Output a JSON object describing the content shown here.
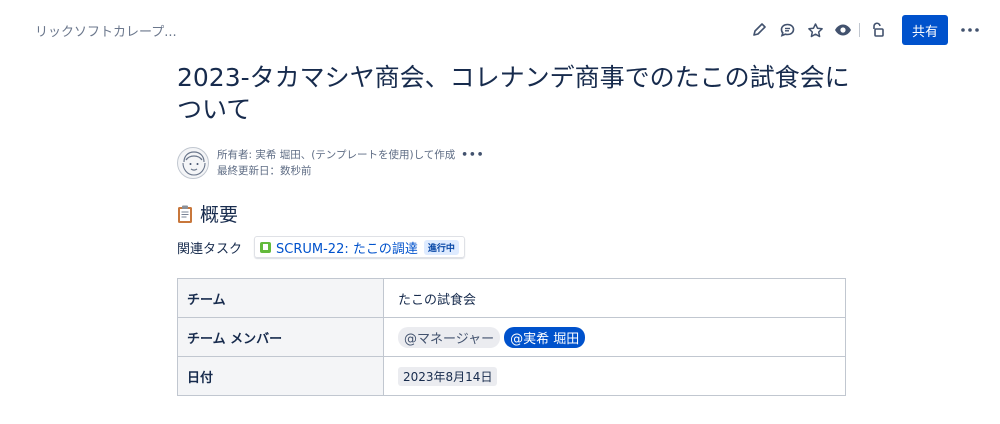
{
  "breadcrumb": "リックソフトカレープ...",
  "toolbar": {
    "icons": [
      "edit-icon",
      "comment-icon",
      "star-icon",
      "watch-icon",
      "restrictions-icon",
      "more-icon"
    ],
    "share_label": "共有"
  },
  "page": {
    "title": "2023-タカマシヤ商会、コレナンデ商事でのたこの試食会について"
  },
  "byline": {
    "line1": "所有者: 実希 堀田、(テンプレートを使用)して作成",
    "line2": "最終更新日：数秒前"
  },
  "section": {
    "title": "概要",
    "icon": "clipboard-icon"
  },
  "related": {
    "label": "関連タスク",
    "issue_text": "SCRUM-22: たこの調達",
    "status": "進行中"
  },
  "table": {
    "rows": [
      {
        "header": "チーム",
        "value": "たこの試食会"
      },
      {
        "header": "チーム メンバー",
        "mentions": [
          "@マネージャー",
          "@実希 堀田"
        ]
      },
      {
        "header": "日付",
        "date": "2023年8月14日"
      }
    ]
  },
  "colors": {
    "primary": "#0052cc",
    "text": "#172b4d",
    "muted": "#5e6c84",
    "story_green": "#63ba3c",
    "lozenge_bg": "#deebff"
  }
}
